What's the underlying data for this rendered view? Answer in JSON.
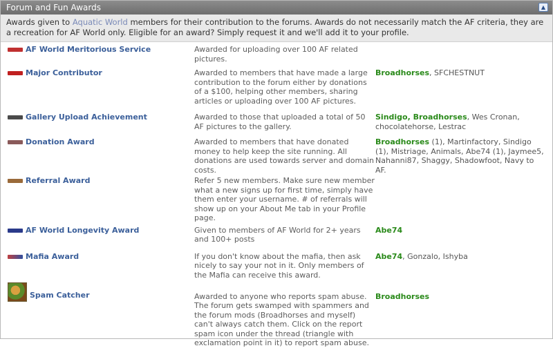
{
  "panel": {
    "title": "Forum and Fun Awards",
    "collapse_icon": "chevron-up-icon"
  },
  "intro": {
    "before": "Awards given to ",
    "site_link": "Aquatic World",
    "after": " members for their contribution to the forums. Awards do not necessarily match the AF criteria, they are a recreation for AF World only. Eligible for an award? Simply request it and we'll add it to your profile."
  },
  "awards": [
    {
      "badge_color": "#c03030",
      "name": "AF World Meritorious Service",
      "description": "Awarded for uploading over 100 AF related pictures.",
      "recipients_green": "",
      "recipients": ""
    },
    {
      "badge_color": "#c02020",
      "name": "Major Contributor",
      "description": "Awarded to members that have made a large contribution to the forum either by donations of a $100, helping other members, sharing articles or uploading over 100 AF pictures.",
      "recipients_green": "Broadhorses",
      "recipients": ", SFCHESTNUT"
    },
    {
      "badge_color": "#4a4a4a",
      "name": "Gallery Upload Achievement",
      "description": "Awarded to those that uploaded a total of 50 AF pictures to the gallery.",
      "recipients_green": "Sindigo, Broadhorses",
      "recipients": ", Wes Cronan, chocolatehorse, Lestrac"
    },
    {
      "badge_color": "#8a5a5a",
      "name": "Donation Award",
      "description": "Awarded to members that have donated money to help keep the site running. All donations are used towards server and domain costs.",
      "recipients_green": "Broadhorses",
      "recipients": " (1), Martinfactory, Sindigo (1), Mistriage, Animals, Abe74 (1), Jaymee5, Nahanni87, Shaggy, Shadowfoot, Navy to AF."
    },
    {
      "badge_color": "#9a6a3a",
      "name": "Referral Award",
      "description": "Refer 5 new members. Make sure new member what a new signs up for first time, simply have them enter your username. # of referrals will show up on your About Me tab in your Profile page.",
      "recipients_green": "",
      "recipients": ""
    },
    {
      "badge_color": "#2a3a8a",
      "name": "AF World Longevity Award",
      "description": "Given to members of AF World for 2+ years and 100+ posts",
      "recipients_green": "Abe74",
      "recipients": ""
    },
    {
      "badge_color": "#c04040",
      "name": "Mafia Award",
      "description": "If you don't know about the mafia, then ask nicely to say your not in it. Only members of the Mafia can receive this award.",
      "recipients_green": "Abe74",
      "recipients": ", Gonzalo, Ishyba"
    },
    {
      "badge_color": "",
      "name": "Spam Catcher",
      "description": "Awarded to anyone who reports spam abuse. The forum gets swamped with spammers and the forum mods (Broadhorses and myself) can't always catch them. Click on the report spam icon under the thread (triangle with exclamation point in it) to report spam abuse.",
      "recipients_green": "Broadhorses",
      "recipients": ""
    }
  ]
}
